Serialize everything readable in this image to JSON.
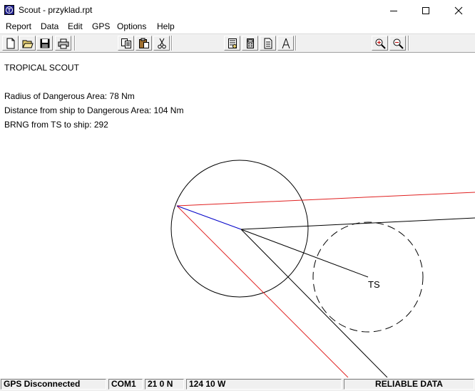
{
  "window": {
    "title": "Scout - przyklad.rpt",
    "icon": "tropical-scout-app-icon",
    "controls": [
      "minimize",
      "maximize",
      "close"
    ]
  },
  "menu": {
    "items": [
      "Report",
      "Data",
      "Edit",
      "GPS",
      "Options",
      "Help"
    ]
  },
  "toolbar": {
    "buttons": [
      "new-file-icon",
      "open-folder-icon",
      "save-disk-icon",
      "print-icon",
      "copy-icon",
      "paste-icon",
      "cut-scissors-icon",
      "report-icon",
      "calculator-icon",
      "document-icon",
      "compass-divider-icon",
      "zoom-in-icon",
      "zoom-out-icon"
    ]
  },
  "report": {
    "heading": "TROPICAL SCOUT",
    "radius_line": "Radius of Dangerous Area: 78 Nm",
    "distance_line": "Distance from ship to Dangerous Area: 104 Nm",
    "bearing_line": "BRNG from TS to ship: 292"
  },
  "plot": {
    "ts_label": "TS",
    "colors": {
      "danger_line": "#e02020",
      "ship_track": "#0000c8",
      "lines": "#000000"
    }
  },
  "status": {
    "gps_state": "GPS Disconnected",
    "port": "COM1",
    "latitude": "21 0 N",
    "longitude": "124 10 W",
    "data_quality": "RELIABLE DATA"
  }
}
